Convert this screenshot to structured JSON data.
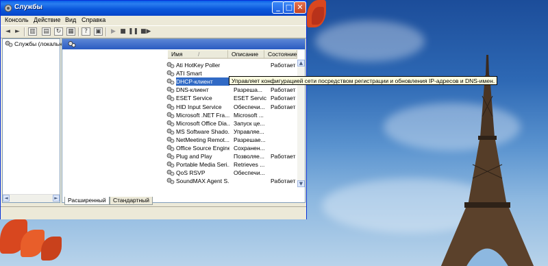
{
  "window": {
    "title": "Службы",
    "minimize_glyph": "_",
    "maximize_glyph": "□",
    "close_glyph": "✕"
  },
  "menu": [
    "Консоль",
    "Действие",
    "Вид",
    "Справка"
  ],
  "tree": {
    "root_label": "Службы (локальные"
  },
  "columns": {
    "name": "Имя",
    "sort_glyph": "/",
    "description": "Описание",
    "status": "Состояние"
  },
  "services": [
    {
      "name": "Ati HotKey Poller",
      "description": "",
      "status": "Работает"
    },
    {
      "name": "ATI Smart",
      "description": "",
      "status": ""
    },
    {
      "name": "DHCP-клиент",
      "description": "",
      "status": "",
      "selected": true
    },
    {
      "name": "DNS-клиент",
      "description": "Разреша...",
      "status": "Работает"
    },
    {
      "name": "ESET Service",
      "description": "ESET Service",
      "status": "Работает"
    },
    {
      "name": "HID Input Service",
      "description": "Обеспечи...",
      "status": "Работает"
    },
    {
      "name": "Microsoft .NET Fra...",
      "description": "Microsoft ...",
      "status": ""
    },
    {
      "name": "Microsoft Office Dia...",
      "description": "Запуск це...",
      "status": ""
    },
    {
      "name": "MS Software Shado...",
      "description": "Управляе...",
      "status": ""
    },
    {
      "name": "NetMeeting Remot...",
      "description": "Разрешае...",
      "status": ""
    },
    {
      "name": "Office Source Engine",
      "description": "Сохранен...",
      "status": ""
    },
    {
      "name": "Plug and Play",
      "description": "Позволяе...",
      "status": "Работает"
    },
    {
      "name": "Portable Media Seri...",
      "description": "Retrieves ...",
      "status": ""
    },
    {
      "name": "QoS RSVP",
      "description": "Обеспечи...",
      "status": ""
    },
    {
      "name": "SoundMAX Agent S...",
      "description": "",
      "status": "Работает"
    }
  ],
  "tooltip": "Управляет конфигурацией сети посредством регистрации и обновления IP-адресов и DNS-имен.",
  "tabs": [
    "Расширенный",
    "Стандартный"
  ],
  "colors": {
    "titlebar": "#0a5fe8",
    "selection": "#316ac5",
    "tooltip_bg": "#ffffe1",
    "leaf": "#d8471f",
    "sky": "#2d68b4"
  },
  "icons": {
    "window": "gear-icon",
    "service": "gears-icon",
    "back": "back-arrow-icon",
    "forward": "forward-arrow-icon",
    "play": "play-icon",
    "stop": "stop-icon",
    "pause": "pause-icon",
    "restart": "restart-icon"
  }
}
